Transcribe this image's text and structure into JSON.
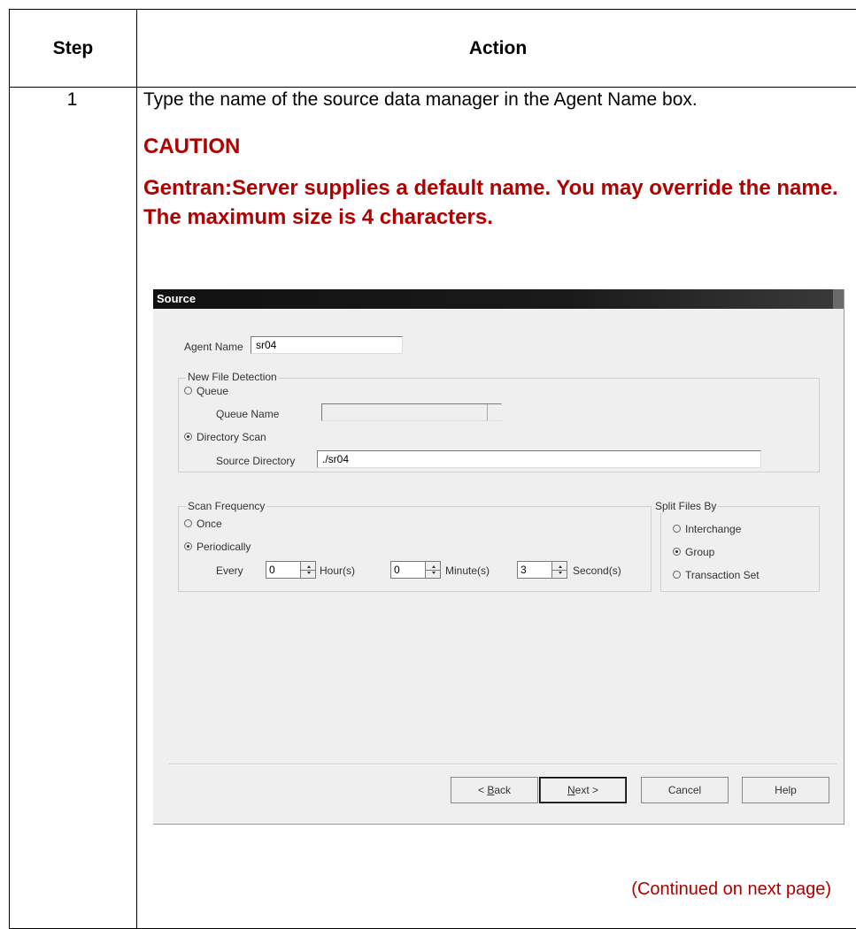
{
  "table": {
    "header_step": "Step",
    "header_action": "Action",
    "step_number": "1",
    "action_text": "Type the name of the source data manager in the Agent Name box.",
    "caution_title": "CAUTION",
    "caution_body": "Gentran:Server supplies a default name. You may override the name. The maximum size is 4 characters.",
    "continued": "(Continued on next page)"
  },
  "dialog": {
    "title": "Source",
    "agent_name_label": "Agent Name",
    "agent_name_value": "sr04",
    "new_file_detection": {
      "group_title": "New File Detection",
      "queue_label": "Queue",
      "queue_selected": false,
      "queue_name_label": "Queue Name",
      "queue_name_value": "",
      "directory_scan_label": "Directory Scan",
      "directory_scan_selected": true,
      "source_directory_label": "Source Directory",
      "source_directory_value": "./sr04"
    },
    "scan_frequency": {
      "group_title": "Scan Frequency",
      "once_label": "Once",
      "periodically_label": "Periodically",
      "selected": "Periodically",
      "every_label": "Every",
      "hours_value": "0",
      "hours_label": "Hour(s)",
      "minutes_value": "0",
      "minutes_label": "Minute(s)",
      "seconds_value": "3",
      "seconds_label": "Second(s)"
    },
    "split_files": {
      "group_title": "Split Files By",
      "options": [
        "Interchange",
        "Group",
        "Transaction Set"
      ],
      "selected": "Group"
    },
    "buttons": {
      "back_prefix": "< ",
      "back_underlined": "B",
      "back_rest": "ack",
      "next_underlined": "N",
      "next_rest": "ext >",
      "cancel": "Cancel",
      "help": "Help"
    }
  }
}
